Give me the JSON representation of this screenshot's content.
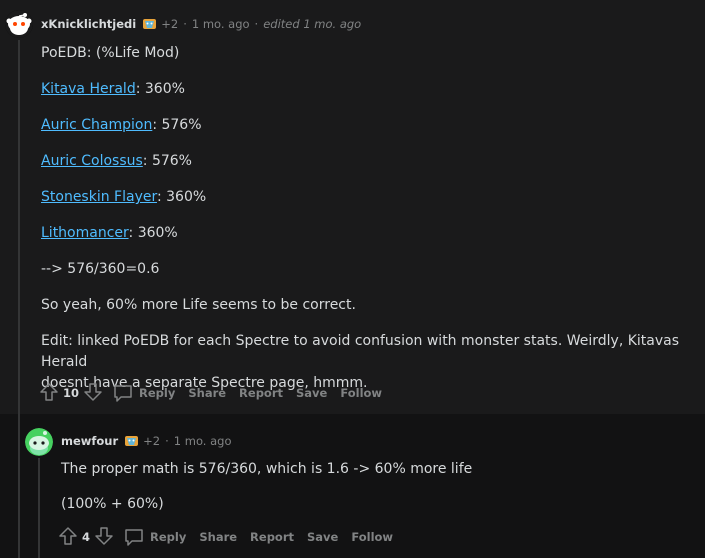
{
  "comments": [
    {
      "username": "xKnicklichtjedi",
      "karma": "+2",
      "age": "1 mo. ago",
      "edited": "edited 1 mo. ago",
      "body": {
        "line1": "PoEDB: (%Life Mod)",
        "links": [
          {
            "name": "Kitava Herald",
            "value": ": 360%"
          },
          {
            "name": "Auric Champion",
            "value": ": 576%"
          },
          {
            "name": "Auric Colossus",
            "value": ": 576%"
          },
          {
            "name": "Stoneskin Flayer",
            "value": ": 360%"
          },
          {
            "name": "Lithomancer",
            "value": ": 360%"
          }
        ],
        "ratio": "--> 576/360=0.6",
        "conclusion": "So yeah, 60% more Life seems to be correct.",
        "edit_line1": "Edit: linked PoEDB for each Spectre to avoid confusion with monster stats. Weirdly, Kitavas Herald",
        "edit_line2": "doesnt have a separate Spectre page, hmmm."
      },
      "votes": "10",
      "actions": {
        "reply": "Reply",
        "share": "Share",
        "report": "Report",
        "save": "Save",
        "follow": "Follow"
      }
    },
    {
      "username": "mewfour",
      "karma": "+2",
      "age": "1 mo. ago",
      "body": {
        "line1": "The proper math is 576/360, which is 1.6 -> 60% more life",
        "line2": "(100% + 60%)"
      },
      "votes": "4",
      "actions": {
        "reply": "Reply",
        "share": "Share",
        "report": "Report",
        "save": "Save",
        "follow": "Follow"
      }
    }
  ]
}
